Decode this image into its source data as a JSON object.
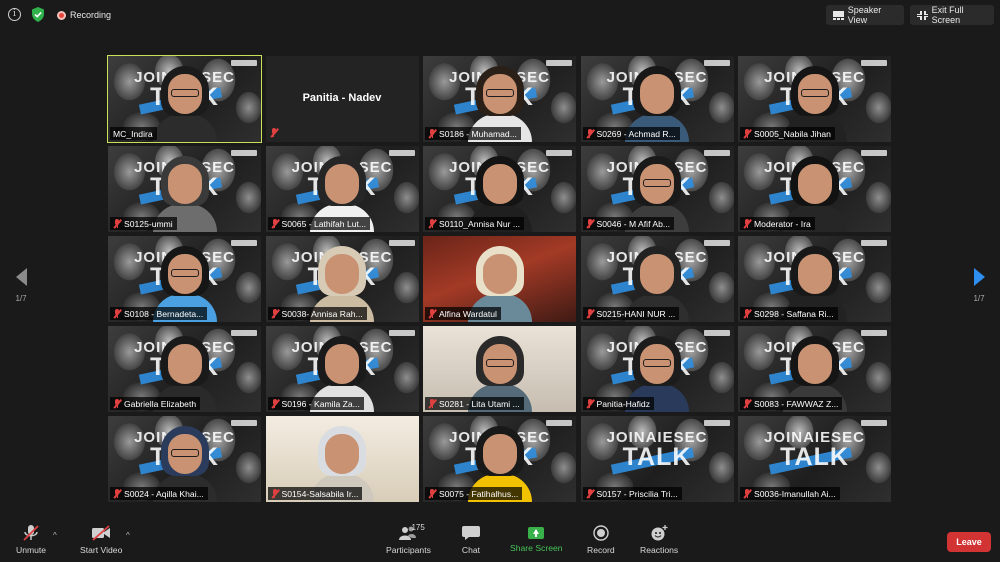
{
  "topbar": {
    "info_icon": "info-icon",
    "security_icon": "shield-icon",
    "recording_label": "Recording",
    "speaker_view_label": "Speaker View",
    "exit_fullscreen_label": "Exit Full Screen"
  },
  "navigation": {
    "prev_page_text": "1/7",
    "next_page_text": "1/7"
  },
  "colors": {
    "active_speaker_border": "#c9e25a",
    "muted_icon": "#e04040",
    "share_screen": "#38b14a",
    "leave_button": "#d23434",
    "next_arrow": "#2e8ff0"
  },
  "tile_background_text": {
    "line1": "JOINAIESEC",
    "line2": "TALK"
  },
  "participants": [
    {
      "name": "MC_Indira",
      "active": true
    },
    {
      "name": "Panitia - Nadev",
      "video": false
    },
    {
      "name": "S0186 - Muhamad..."
    },
    {
      "name": "S0269 - Achmad R..."
    },
    {
      "name": "S0005_Nabila Jihan"
    },
    {
      "name": "S0125-ummi"
    },
    {
      "name": "S0065 - Lathifah Lut..."
    },
    {
      "name": "S0110_Annisa Nur ..."
    },
    {
      "name": "S0046 - M Afif Ab..."
    },
    {
      "name": "Moderator - Ira"
    },
    {
      "name": "S0108 - Bernadeta..."
    },
    {
      "name": "S0038- Annisa Rah..."
    },
    {
      "name": "Alfina Wardatul"
    },
    {
      "name": "S0215-HANI NUR ..."
    },
    {
      "name": "S0298 - Saffana Ri..."
    },
    {
      "name": "Gabriella Elizabeth"
    },
    {
      "name": "S0196 - Kamila Za..."
    },
    {
      "name": "S0281 - Lita Utami ..."
    },
    {
      "name": "Panitia-Hafidz"
    },
    {
      "name": "S0083 - FAWWAZ Z..."
    },
    {
      "name": "S0024 - Aqilla Khai..."
    },
    {
      "name": "S0154-Salsabila Ir..."
    },
    {
      "name": "S0075 - Fatihalhus..."
    },
    {
      "name": "S0157 - Priscilia Tri..."
    },
    {
      "name": "S0036-Imanullah Ai..."
    }
  ],
  "toolbar": {
    "unmute_label": "Unmute",
    "start_video_label": "Start Video",
    "participants_label": "Participants",
    "participants_count": "175",
    "chat_label": "Chat",
    "share_screen_label": "Share Screen",
    "record_label": "Record",
    "reactions_label": "Reactions",
    "leave_label": "Leave"
  }
}
